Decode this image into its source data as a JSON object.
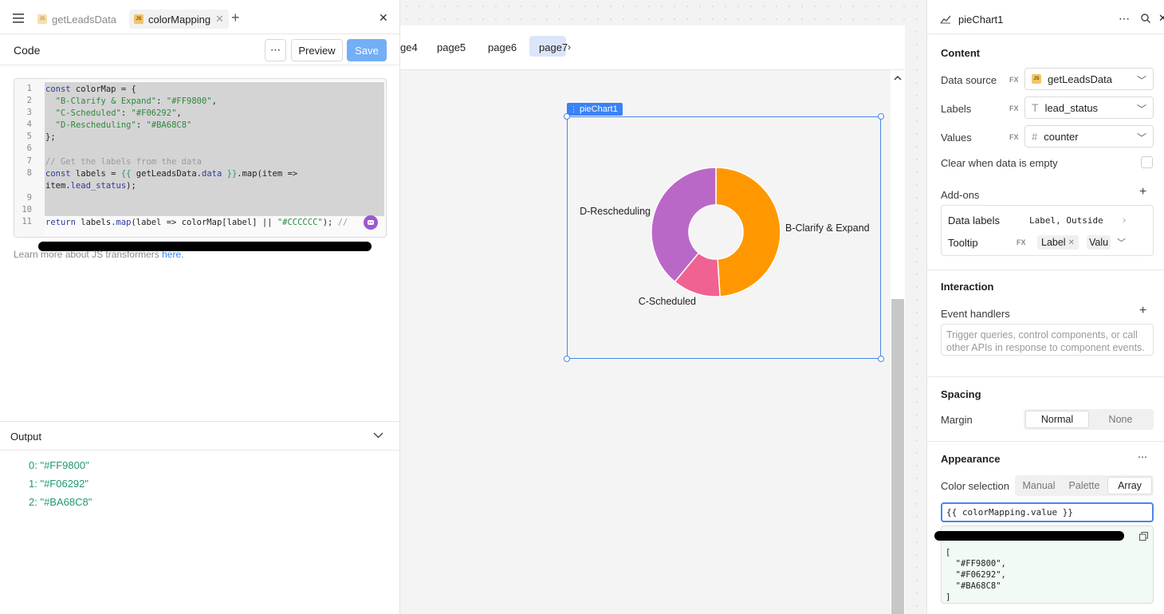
{
  "left_panel": {
    "tabs": [
      {
        "label": "getLeadsData",
        "active": false
      },
      {
        "label": "colorMapping",
        "active": true
      }
    ],
    "header_title": "Code",
    "preview_label": "Preview",
    "save_label": "Save",
    "code_lines": [
      {
        "n": "1",
        "html": "<span class='kw'>const</span> colorMap = {"
      },
      {
        "n": "2",
        "html": "  <span class='str'>\"B-Clarify & Expand\"</span>: <span class='str'>\"#FF9800\"</span>,"
      },
      {
        "n": "3",
        "html": "  <span class='str'>\"C-Scheduled\"</span>: <span class='str'>\"#F06292\"</span>,"
      },
      {
        "n": "4",
        "html": "  <span class='str'>\"D-Rescheduling\"</span>: <span class='str'>\"#BA68C8\"</span>"
      },
      {
        "n": "5",
        "html": "};"
      },
      {
        "n": "6",
        "html": ""
      },
      {
        "n": "7",
        "html": "<span class='cmt'>// Get the labels from the data</span>"
      },
      {
        "n": "8",
        "html": "<span class='kw'>const</span> labels = <span class='tmpl'>{{</span> getLeadsData.<span class='kw'>data</span> <span class='tmpl'>}}</span>.map(item =>"
      },
      {
        "n": "",
        "html": "item.<span class='kw'>lead_status</span>);"
      },
      {
        "n": "9",
        "html": ""
      },
      {
        "n": "10",
        "html": ""
      },
      {
        "n": "11",
        "html": "<span class='kw'>return</span> labels.<span class='kw'>map</span>(label => colorMap[label] || <span class='str'>\"#CCCCCC\"</span>); <span class='cmt'>//</span>"
      }
    ],
    "help_text": "Learn more about JS transformers",
    "help_link": "here.",
    "output_title": "Output",
    "output_lines": [
      "0: \"#FF9800\"",
      "1: \"#F06292\"",
      "2: \"#BA68C8\""
    ]
  },
  "canvas": {
    "pages": [
      "ge4",
      "page5",
      "page6",
      "page7"
    ],
    "selected_label": "pieChart1"
  },
  "chart_data": {
    "type": "pie",
    "donut": true,
    "categories": [
      "B-Clarify & Expand",
      "C-Scheduled",
      "D-Rescheduling"
    ],
    "values": [
      49,
      12,
      39
    ],
    "colors": [
      "#FF9800",
      "#F06292",
      "#BA68C8"
    ],
    "labels_position": "outside"
  },
  "inspector": {
    "title": "pieChart1",
    "content_title": "Content",
    "data_source_label": "Data source",
    "data_source_value": "getLeadsData",
    "labels_label": "Labels",
    "labels_value": "lead_status",
    "values_label": "Values",
    "values_value": "counter",
    "fx": "FX",
    "clear_label": "Clear when data is empty",
    "addons_label": "Add-ons",
    "data_labels_label": "Data labels",
    "data_labels_value": "Label, Outside",
    "tooltip_label": "Tooltip",
    "tooltip_tag1": "Label",
    "tooltip_tag2": "Valu",
    "interaction_title": "Interaction",
    "event_handlers_label": "Event handlers",
    "event_placeholder": "Trigger queries, control components, or call other APIs in response to component events.",
    "spacing_title": "Spacing",
    "margin_label": "Margin",
    "margin_normal": "Normal",
    "margin_none": "None",
    "appearance_title": "Appearance",
    "color_selection_label": "Color selection",
    "color_manual": "Manual",
    "color_palette": "Palette",
    "color_array": "Array",
    "color_input_value": "{{ colorMapping.value }}",
    "preview_lines": [
      "[",
      "  \"#FF9800\",",
      "  \"#F06292\",",
      "  \"#BA68C8\"",
      "]"
    ]
  }
}
